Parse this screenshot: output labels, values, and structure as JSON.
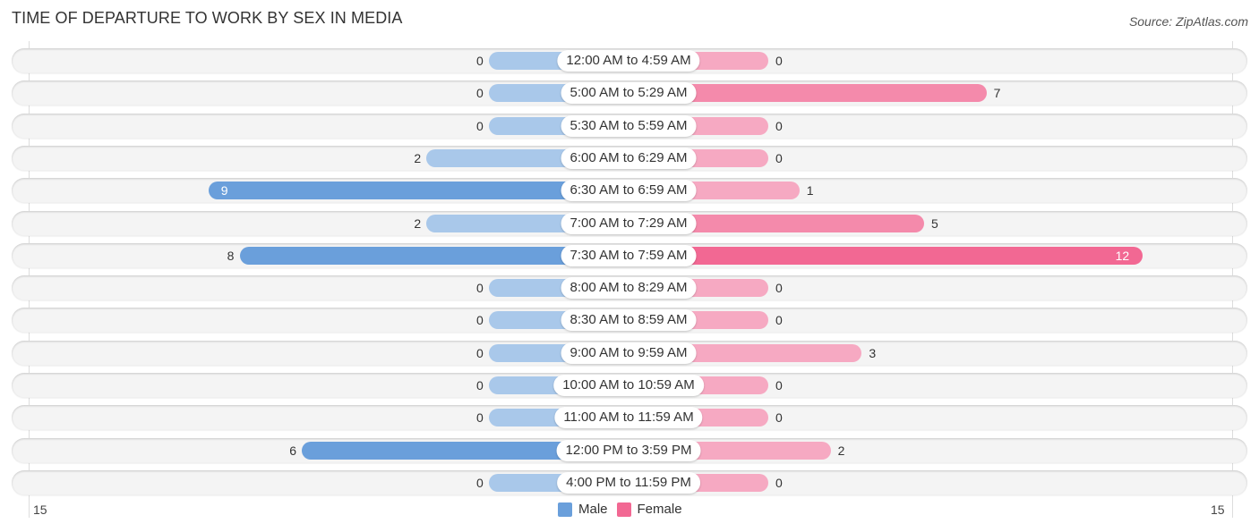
{
  "header": {
    "title": "TIME OF DEPARTURE TO WORK BY SEX IN MEDIA",
    "source": "Source: ZipAtlas.com"
  },
  "colors": {
    "male_strong": "#6a9fdb",
    "male_light": "#a9c8ea",
    "female_strong": "#f26893",
    "female_light": "#f6a9c2"
  },
  "chart_data": {
    "type": "bar",
    "orientation": "horizontal-diverging",
    "title": "TIME OF DEPARTURE TO WORK BY SEX IN MEDIA",
    "categories": [
      "12:00 AM to 4:59 AM",
      "5:00 AM to 5:29 AM",
      "5:30 AM to 5:59 AM",
      "6:00 AM to 6:29 AM",
      "6:30 AM to 6:59 AM",
      "7:00 AM to 7:29 AM",
      "7:30 AM to 7:59 AM",
      "8:00 AM to 8:29 AM",
      "8:30 AM to 8:59 AM",
      "9:00 AM to 9:59 AM",
      "10:00 AM to 10:59 AM",
      "11:00 AM to 11:59 AM",
      "12:00 PM to 3:59 PM",
      "4:00 PM to 11:59 PM"
    ],
    "series": [
      {
        "name": "Male",
        "values": [
          0,
          0,
          0,
          2,
          9,
          2,
          8,
          0,
          0,
          0,
          0,
          0,
          6,
          0
        ]
      },
      {
        "name": "Female",
        "values": [
          0,
          7,
          0,
          0,
          1,
          5,
          12,
          0,
          0,
          3,
          0,
          0,
          2,
          0
        ]
      }
    ],
    "xlim": [
      -15,
      15
    ],
    "tick_labels": {
      "left": "15",
      "right": "15"
    },
    "legend": {
      "position": "bottom-center",
      "entries": [
        "Male",
        "Female"
      ]
    },
    "grid": false
  }
}
